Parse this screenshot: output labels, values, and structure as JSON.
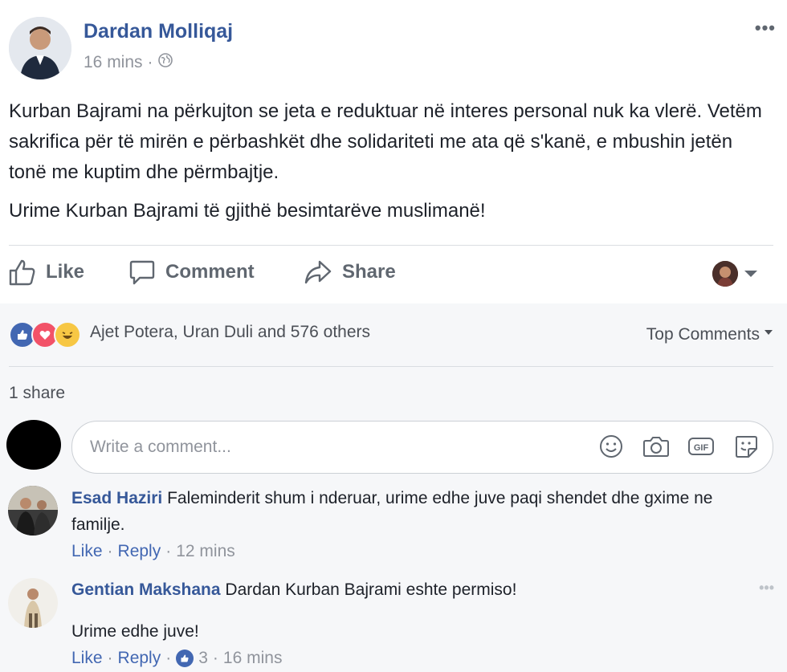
{
  "post": {
    "author": "Dardan Molliqaj",
    "time": "16 mins",
    "separator": "·",
    "more": "•••",
    "text_p1": "Kurban Bajrami na përkujton se jeta e reduktuar në interes personal nuk ka vlerë. Vetëm sakrifica për të mirën e përbashkët dhe solidariteti me ata që s'kanë, e mbushin jetën tonë me kuptim dhe përmbajtje.",
    "text_p2": "Urime Kurban Bajrami të gjithë besimtarëve muslimanë!"
  },
  "actions": {
    "like": "Like",
    "comment": "Comment",
    "share": "Share"
  },
  "reactions": {
    "types": [
      "like",
      "love",
      "haha"
    ],
    "summary": "Ajet Potera, Uran Duli and 576 others",
    "sort_label": "Top Comments"
  },
  "shares": "1 share",
  "composer": {
    "placeholder": "Write a comment...",
    "icons": [
      "smiley-icon",
      "camera-icon",
      "gif-icon",
      "sticker-icon"
    ]
  },
  "comments": [
    {
      "name": "Esad Haziri",
      "text": "Faleminderit shum i nderuar, urime edhe juve paqi shendet dhe gxime ne familje.",
      "like": "Like",
      "reply": "Reply",
      "time": "12 mins"
    },
    {
      "name": "Gentian Makshana",
      "text": "Dardan Kurban Bajrami eshte permiso!",
      "text2": "Urime edhe juve!",
      "like": "Like",
      "reply": "Reply",
      "like_count": "3",
      "time": "16 mins",
      "more": "•••"
    }
  ],
  "colors": {
    "link": "#365899",
    "accent": "#4267b2",
    "muted": "#90949c",
    "background_alt": "#f6f7f9"
  }
}
